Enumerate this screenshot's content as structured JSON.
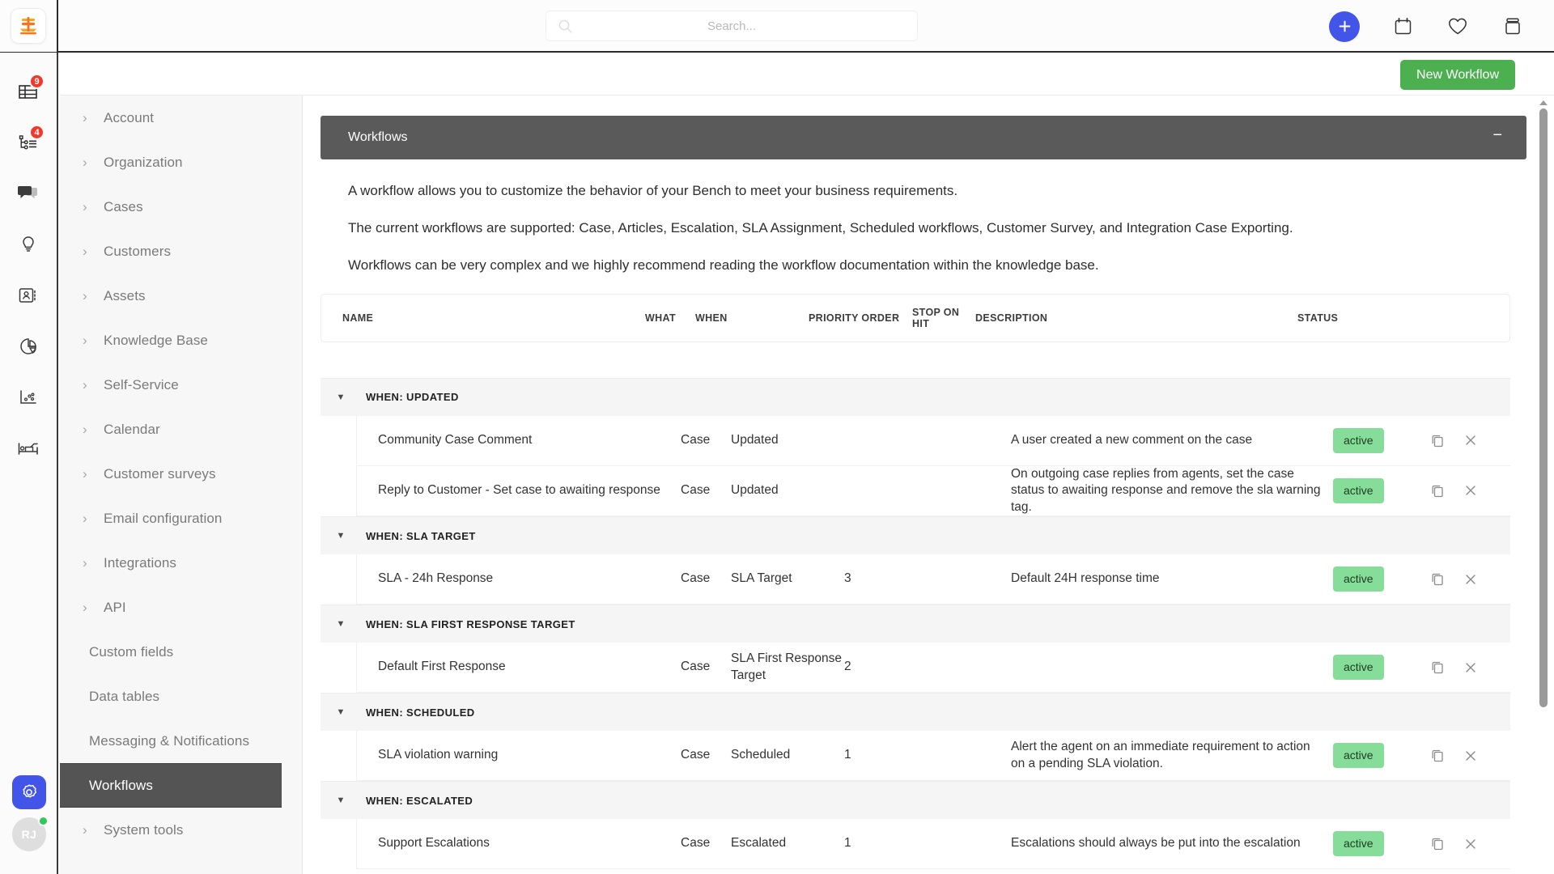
{
  "app": {
    "logo_name": "app-logo",
    "accent_blue": "#4355e8",
    "accent_green": "#4caf50",
    "badge_red": "#f0392b",
    "status_green": "#86dd99"
  },
  "topbar": {
    "search_placeholder": "Search...",
    "search_value": "",
    "actions": [
      {
        "name": "add-button",
        "icon": "plus-icon"
      },
      {
        "name": "calendar-button",
        "icon": "calendar-icon"
      },
      {
        "name": "favorites-button",
        "icon": "heart-icon"
      },
      {
        "name": "archive-button",
        "icon": "box-icon"
      }
    ]
  },
  "rail": {
    "items": [
      {
        "name": "sidebar-item-dashboard",
        "icon": "table-grid-icon",
        "badge": "9"
      },
      {
        "name": "sidebar-item-cases",
        "icon": "hierarchy-list-icon",
        "badge": "4"
      },
      {
        "name": "sidebar-item-messages",
        "icon": "chat-bubbles-icon",
        "badge": ""
      },
      {
        "name": "sidebar-item-ideas",
        "icon": "lightbulb-icon",
        "badge": ""
      },
      {
        "name": "sidebar-item-contacts",
        "icon": "contact-card-icon",
        "badge": ""
      },
      {
        "name": "sidebar-item-reports",
        "icon": "pie-chart-icon",
        "badge": ""
      },
      {
        "name": "sidebar-item-analytics",
        "icon": "scatter-plot-icon",
        "badge": ""
      },
      {
        "name": "sidebar-item-assets",
        "icon": "bed-desk-icon",
        "badge": ""
      }
    ],
    "settings_icon": "gear-icon",
    "avatar_initials": "RJ",
    "presence": "online"
  },
  "mainhead": {
    "new_workflow_label": "New Workflow"
  },
  "nav": {
    "items": [
      {
        "label": "Account",
        "expandable": true,
        "active": false
      },
      {
        "label": "Organization",
        "expandable": true,
        "active": false
      },
      {
        "label": "Cases",
        "expandable": true,
        "active": false
      },
      {
        "label": "Customers",
        "expandable": true,
        "active": false
      },
      {
        "label": "Assets",
        "expandable": true,
        "active": false
      },
      {
        "label": "Knowledge Base",
        "expandable": true,
        "active": false
      },
      {
        "label": "Self-Service",
        "expandable": true,
        "active": false
      },
      {
        "label": "Calendar",
        "expandable": true,
        "active": false
      },
      {
        "label": "Customer surveys",
        "expandable": true,
        "active": false
      },
      {
        "label": "Email configuration",
        "expandable": true,
        "active": false
      },
      {
        "label": "Integrations",
        "expandable": true,
        "active": false
      },
      {
        "label": "API",
        "expandable": true,
        "active": false
      },
      {
        "label": "Custom fields",
        "expandable": false,
        "active": false
      },
      {
        "label": "Data tables",
        "expandable": false,
        "active": false
      },
      {
        "label": "Messaging & Notifications",
        "expandable": false,
        "active": false
      },
      {
        "label": "Workflows",
        "expandable": false,
        "active": true
      },
      {
        "label": "System tools",
        "expandable": true,
        "active": false
      }
    ]
  },
  "panel": {
    "title": "Workflows",
    "collapse_glyph": "−",
    "description": [
      "A workflow allows you to customize the behavior of your Bench to meet your business requirements.",
      "The current workflows are supported: Case, Articles, Escalation, SLA Assignment, Scheduled workflows, Customer Survey, and Integration Case Exporting.",
      "Workflows can be very complex and we highly recommend reading the workflow documentation within the knowledge base."
    ]
  },
  "table": {
    "columns": [
      "NAME",
      "WHAT",
      "WHEN",
      "PRIORITY ORDER",
      "STOP ON HIT",
      "DESCRIPTION",
      "STATUS"
    ],
    "groups": [
      {
        "label": "WHEN: UPDATED",
        "expanded": true,
        "rows": [
          {
            "name": "Community Case Comment",
            "what": "Case",
            "when": "Updated",
            "priority": "",
            "stop_on_hit": "",
            "description": "A user created a new comment on the case",
            "status": "active"
          },
          {
            "name": "Reply to Customer - Set case to awaiting response",
            "what": "Case",
            "when": "Updated",
            "priority": "",
            "stop_on_hit": "",
            "description": "On outgoing case replies from agents, set the case status to awaiting response and remove the sla warning tag.",
            "status": "active"
          }
        ]
      },
      {
        "label": "WHEN: SLA TARGET",
        "expanded": true,
        "rows": [
          {
            "name": "SLA - 24h Response",
            "what": "Case",
            "when": "SLA Target",
            "priority": "3",
            "stop_on_hit": "",
            "description": "Default 24H response time",
            "status": "active"
          }
        ]
      },
      {
        "label": "WHEN: SLA FIRST RESPONSE TARGET",
        "expanded": true,
        "rows": [
          {
            "name": "Default First Response",
            "what": "Case",
            "when": "SLA First Response Target",
            "priority": "2",
            "stop_on_hit": "",
            "description": "",
            "status": "active"
          }
        ]
      },
      {
        "label": "WHEN: SCHEDULED",
        "expanded": true,
        "rows": [
          {
            "name": "SLA violation warning",
            "what": "Case",
            "when": "Scheduled",
            "priority": "1",
            "stop_on_hit": "",
            "description": "Alert the agent on an immediate requirement to action on a pending SLA violation.",
            "status": "active"
          }
        ]
      },
      {
        "label": "WHEN: ESCALATED",
        "expanded": true,
        "rows": [
          {
            "name": "Support Escalations",
            "what": "Case",
            "when": "Escalated",
            "priority": "1",
            "stop_on_hit": "",
            "description": "Escalations should always be put into the escalation",
            "status": "active"
          }
        ]
      }
    ],
    "row_actions": [
      {
        "name": "duplicate-row-button",
        "icon": "copy-icon"
      },
      {
        "name": "delete-row-button",
        "icon": "close-icon"
      }
    ]
  }
}
